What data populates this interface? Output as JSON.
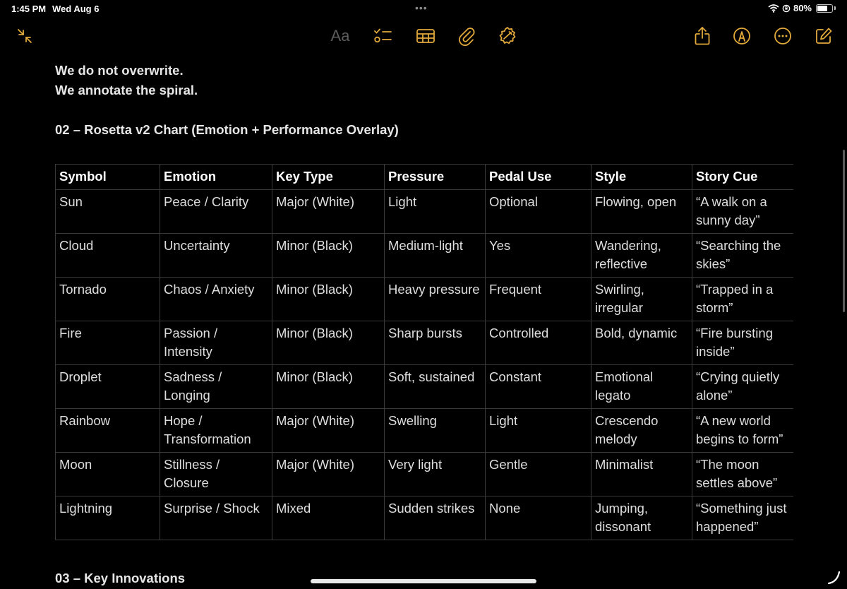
{
  "status_bar": {
    "time": "1:45 PM",
    "date": "Wed Aug 6",
    "battery": "80%",
    "battery_level": 0.8
  },
  "toolbar": {
    "format_label": "Aa",
    "accent_color": "#e2a93b"
  },
  "note": {
    "lines": [
      "We do not overwrite.",
      "We annotate the spiral."
    ],
    "heading_02": "02 – Rosetta v2 Chart (Emotion + Performance Overlay)",
    "heading_03": "03 – Key Innovations"
  },
  "table": {
    "headers": [
      "Symbol",
      "Emotion",
      "Key Type",
      "Pressure",
      "Pedal Use",
      "Style",
      "Story Cue"
    ],
    "rows": [
      [
        "Sun",
        "Peace / Clarity",
        "Major (White)",
        "Light",
        "Optional",
        "Flowing, open",
        "“A walk on a sunny day”"
      ],
      [
        "Cloud",
        "Uncertainty",
        "Minor (Black)",
        "Medium-light",
        "Yes",
        "Wandering, reflective",
        "“Searching the skies”"
      ],
      [
        "Tornado",
        "Chaos / Anxiety",
        "Minor (Black)",
        "Heavy pressure",
        "Frequent",
        "Swirling, irregular",
        "“Trapped in a storm”"
      ],
      [
        "Fire",
        "Passion / Intensity",
        "Minor (Black)",
        "Sharp bursts",
        "Controlled",
        "Bold, dynamic",
        "“Fire bursting inside”"
      ],
      [
        "Droplet",
        "Sadness / Longing",
        "Minor (Black)",
        "Soft, sustained",
        "Constant",
        "Emotional legato",
        "“Crying quietly alone”"
      ],
      [
        "Rainbow",
        "Hope / Transformation",
        "Major (White)",
        "Swelling",
        "Light",
        "Crescendo melody",
        "“A new world begins to form”"
      ],
      [
        "Moon",
        "Stillness / Closure",
        "Major (White)",
        "Very light",
        "Gentle",
        "Minimalist",
        "“The moon settles above”"
      ],
      [
        "Lightning",
        "Surprise / Shock",
        "Mixed",
        "Sudden strikes",
        "None",
        "Jumping, dissonant",
        "“Something just happened”"
      ]
    ]
  }
}
